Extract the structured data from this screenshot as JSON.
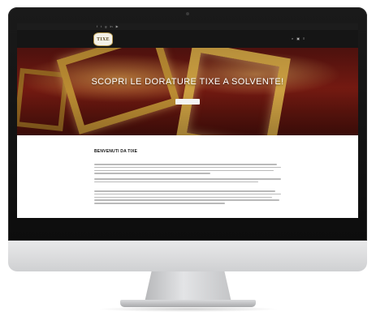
{
  "website": {
    "topbar": {
      "social_icons": [
        "facebook-icon",
        "twitter-icon",
        "google-plus-icon",
        "linkedin-icon",
        "youtube-icon"
      ],
      "social_glyphs": [
        "f",
        "t",
        "g",
        "in",
        "▶"
      ],
      "contacts": ""
    },
    "logo": {
      "text": "TIXE"
    },
    "nav": {
      "items": [
        "",
        "",
        "",
        "",
        "",
        "",
        ""
      ],
      "icons": [
        "search-icon",
        "cart-icon",
        "menu-icon"
      ],
      "icon_glyphs": [
        "⌕",
        "▣",
        "≡"
      ]
    },
    "hero": {
      "title": "SCOPRI LE DORATURE TIXE A SOLVENTE!",
      "subtitle": "",
      "button_label": ""
    },
    "welcome": {
      "title": "BENVENUTI DA TIXE",
      "subtitle": ""
    }
  },
  "colors": {
    "navbar": "#151515",
    "accent_gold": "#c59335",
    "hero_red": "#7a1b12"
  }
}
